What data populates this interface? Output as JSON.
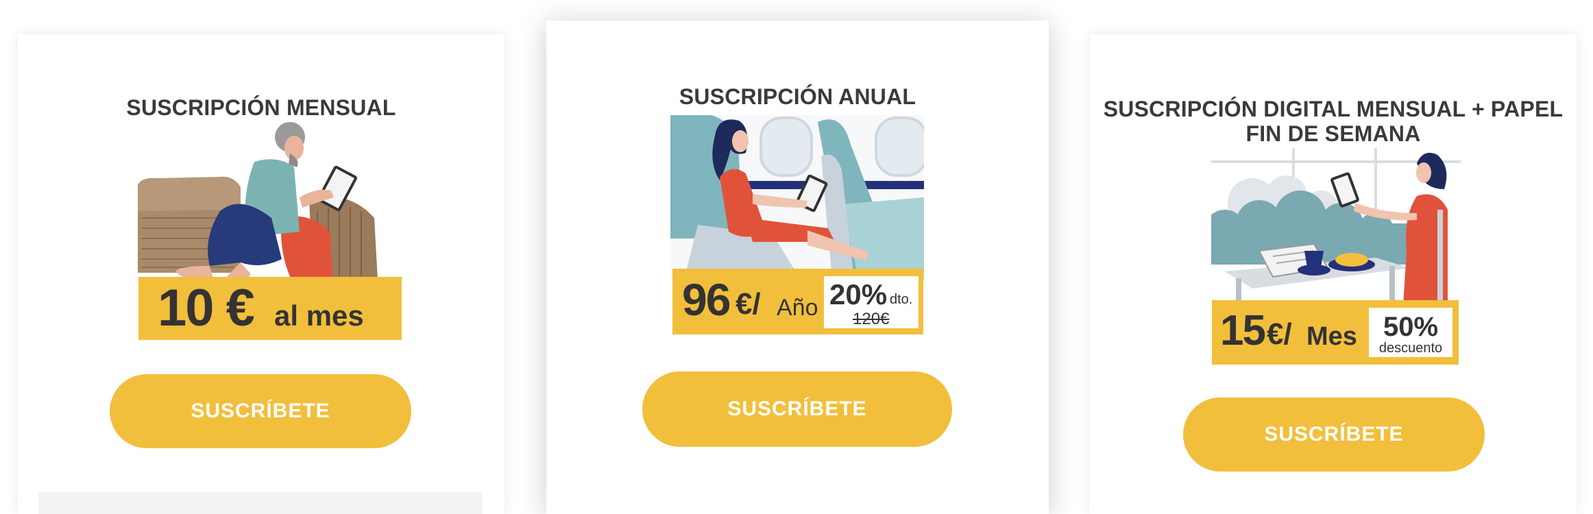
{
  "cards": [
    {
      "title": "SUSCRIPCIÓN MENSUAL",
      "price_amount": "10 €",
      "price_period": "al mes",
      "button_label": "SUSCRÍBETE"
    },
    {
      "title": "SUSCRIPCIÓN ANUAL",
      "price_amount": "96",
      "price_unit": "€/",
      "price_period": "Año",
      "discount_pct": "20%",
      "discount_label": "dto.",
      "old_price": "120€",
      "button_label": "SUSCRÍBETE"
    },
    {
      "title_line1": "SUSCRIPCIÓN DIGITAL MENSUAL + PAPEL",
      "title_line2": "FIN DE SEMANA",
      "price_amount": "15",
      "price_unit": "€/",
      "price_period": "Mes",
      "discount_pct": "50%",
      "discount_label": "descuento",
      "button_label": "SUSCRÍBETE"
    }
  ],
  "colors": {
    "accent": "#f2bf3c",
    "text": "#3a3a3a",
    "button_text": "#ffffff"
  }
}
